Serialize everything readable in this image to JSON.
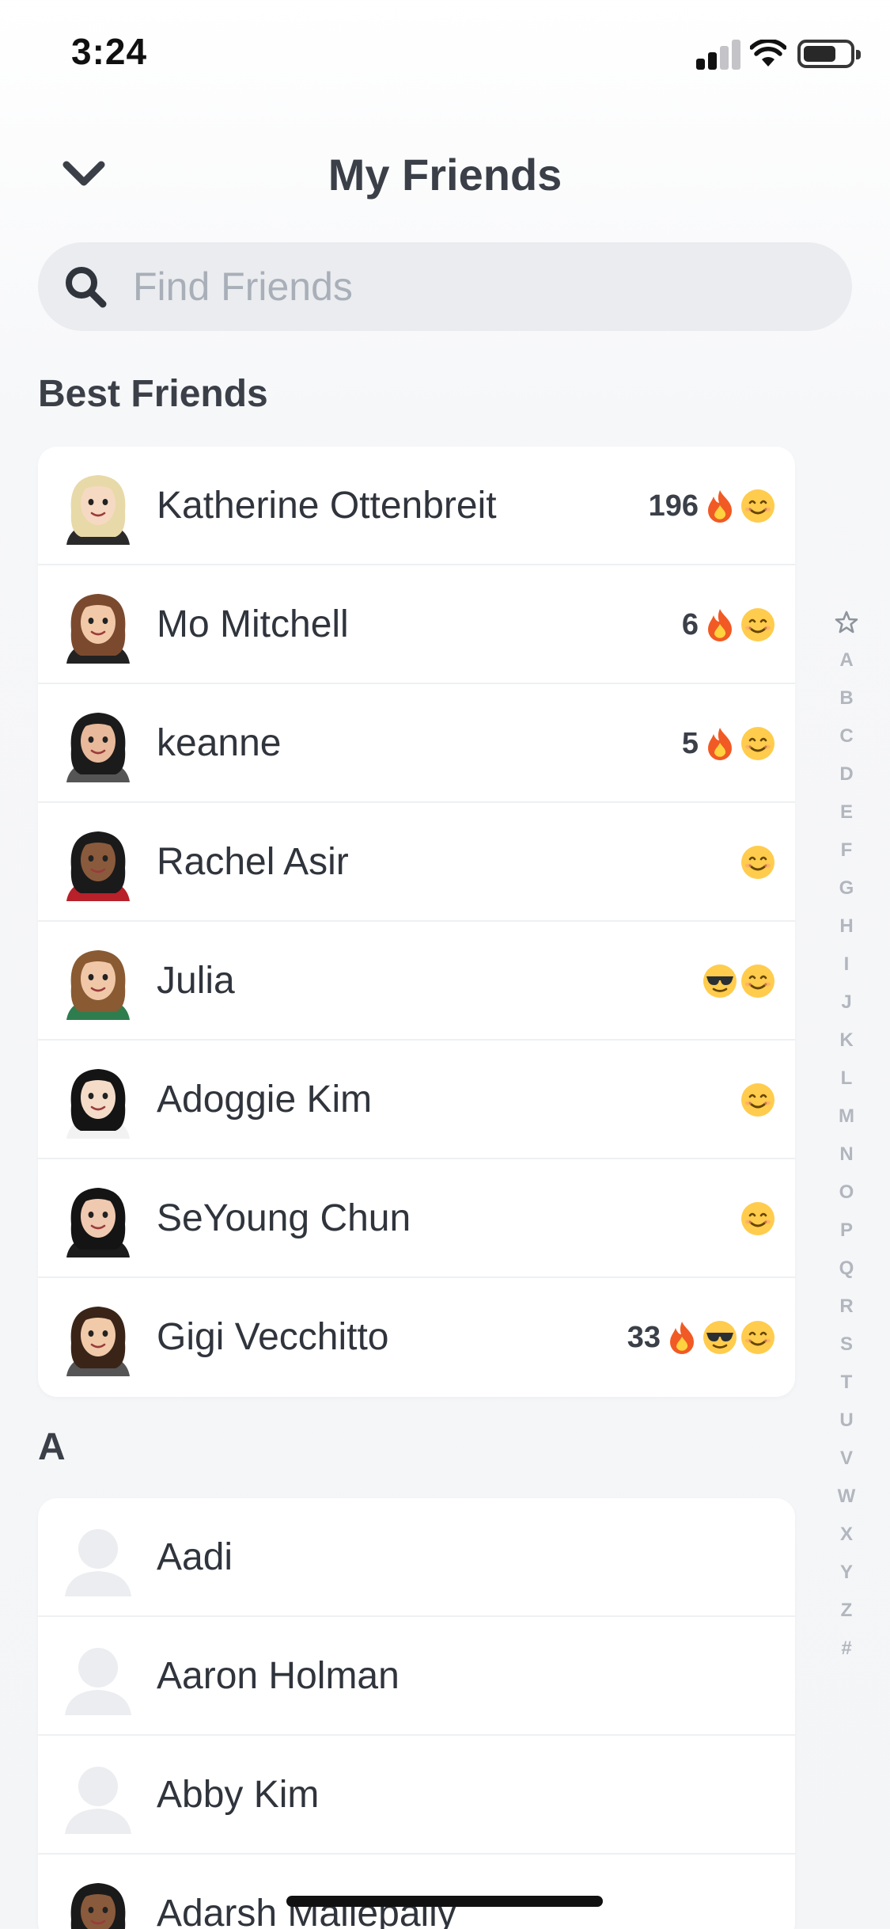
{
  "status_bar": {
    "time": "3:24"
  },
  "header": {
    "title": "My Friends"
  },
  "search": {
    "placeholder": "Find Friends",
    "value": ""
  },
  "best_friends": {
    "title": "Best Friends",
    "items": [
      {
        "name": "Katherine Ottenbreit",
        "streak": "196",
        "badges": [
          "fire",
          "smile"
        ],
        "avatar": {
          "hair": "#e8d9a8",
          "skin": "#f6d9c2",
          "shirt": "#2a2a2a"
        }
      },
      {
        "name": "Mo Mitchell",
        "streak": "6",
        "badges": [
          "fire",
          "smile"
        ],
        "avatar": {
          "hair": "#7b4a2e",
          "skin": "#f2c9a8",
          "shirt": "#222222"
        }
      },
      {
        "name": "keanne",
        "streak": "5",
        "badges": [
          "fire",
          "smile"
        ],
        "avatar": {
          "hair": "#1b1b1b",
          "skin": "#e8b99a",
          "shirt": "#555555"
        }
      },
      {
        "name": "Rachel Asir",
        "streak": "",
        "badges": [
          "smile"
        ],
        "avatar": {
          "hair": "#1a1a1a",
          "skin": "#8a5a3c",
          "shirt": "#b8202a"
        }
      },
      {
        "name": "Julia",
        "streak": "",
        "badges": [
          "cool",
          "smile"
        ],
        "avatar": {
          "hair": "#8a5a32",
          "skin": "#f0c8a8",
          "shirt": "#2e7d4f"
        }
      },
      {
        "name": "Adoggie Kim",
        "streak": "",
        "badges": [
          "smile"
        ],
        "avatar": {
          "hair": "#141414",
          "skin": "#f4dcc8",
          "shirt": "#f2f2f2"
        }
      },
      {
        "name": "SeYoung Chun",
        "streak": "",
        "badges": [
          "smile"
        ],
        "avatar": {
          "hair": "#141414",
          "skin": "#efc9b0",
          "shirt": "#1c1c1c"
        }
      },
      {
        "name": "Gigi Vecchitto",
        "streak": "33",
        "badges": [
          "fire",
          "cool",
          "smile"
        ],
        "avatar": {
          "hair": "#3a2418",
          "skin": "#f1caa9",
          "shirt": "#555555"
        }
      }
    ]
  },
  "section_a": {
    "title": "A",
    "items": [
      {
        "name": "Aadi",
        "avatar": {
          "placeholder": true
        }
      },
      {
        "name": "Aaron Holman",
        "avatar": {
          "placeholder": true
        }
      },
      {
        "name": "Abby Kim",
        "avatar": {
          "placeholder": true
        }
      },
      {
        "name": "Adarsh Mallepally",
        "avatar": {
          "hair": "#1a1a1a",
          "skin": "#8a5a3c",
          "shirt": "#333333"
        }
      }
    ]
  },
  "index_letters": [
    "A",
    "B",
    "C",
    "D",
    "E",
    "F",
    "G",
    "H",
    "I",
    "J",
    "K",
    "L",
    "M",
    "N",
    "O",
    "P",
    "Q",
    "R",
    "S",
    "T",
    "U",
    "V",
    "W",
    "X",
    "Y",
    "Z",
    "#"
  ],
  "colors": {
    "text": "#3b3f48",
    "search_bg": "#eaecef",
    "placeholder": "#a9afb8",
    "index": "#b2b6be",
    "divider": "#eef0f2"
  },
  "icons": {
    "back": "chevron-down-icon",
    "search": "search-icon",
    "index_top": "star-icon"
  }
}
